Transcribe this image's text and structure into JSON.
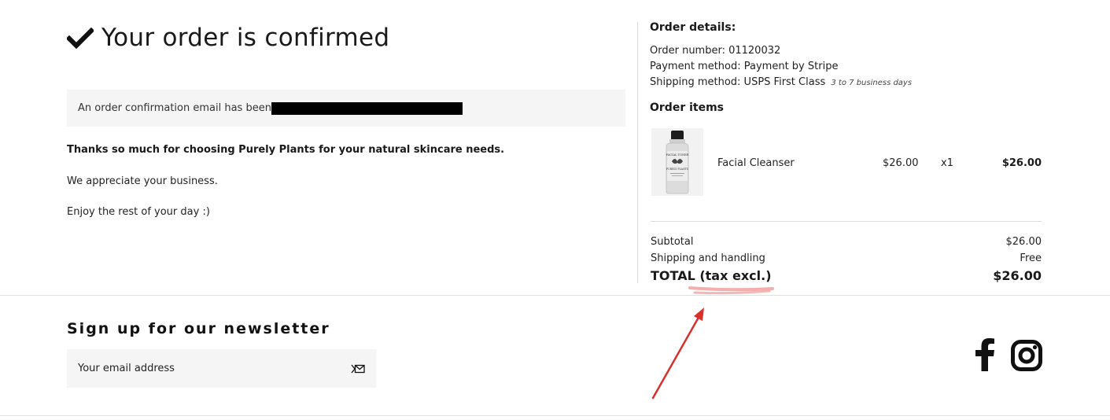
{
  "confirmation": {
    "title": "Your order is confirmed",
    "icon": "checkmark-icon",
    "email_notice": "An order confirmation email has been",
    "thanks": "Thanks so much for choosing Purely Plants for your natural skincare needs.",
    "appreciate": "We appreciate your business.",
    "enjoy": "Enjoy the rest of your day :)"
  },
  "order_details": {
    "heading": "Order details:",
    "order_number": "Order number: 01120032",
    "payment_method": "Payment method: Payment by Stripe",
    "shipping_method": "Shipping method: USPS First Class",
    "shipping_note": "3 to 7 business days"
  },
  "order_items": {
    "heading": "Order items",
    "items": [
      {
        "name": "Facial Cleanser",
        "unit_price": "$26.00",
        "quantity": "x1",
        "total": "$26.00",
        "bottle_label_line1": "FACIAL TONER",
        "bottle_label_line2": "PURELY PLANTS"
      }
    ]
  },
  "summary": {
    "subtotal_label": "Subtotal",
    "subtotal_value": "$26.00",
    "shipping_label": "Shipping and handling",
    "shipping_value": "Free",
    "total_label": "TOTAL (tax excl.)",
    "total_value": "$26.00"
  },
  "newsletter": {
    "title": "Sign up for our newsletter",
    "placeholder": "Your email address",
    "submit_icon": "send-mail-icon"
  },
  "social": {
    "icons": [
      "facebook-icon",
      "instagram-icon"
    ]
  },
  "colors": {
    "text": "#1a1a1a",
    "panel_background": "#f5f5f5",
    "annotation_arrow": "#d9302b",
    "annotation_highlight": "#f3a5a3"
  }
}
